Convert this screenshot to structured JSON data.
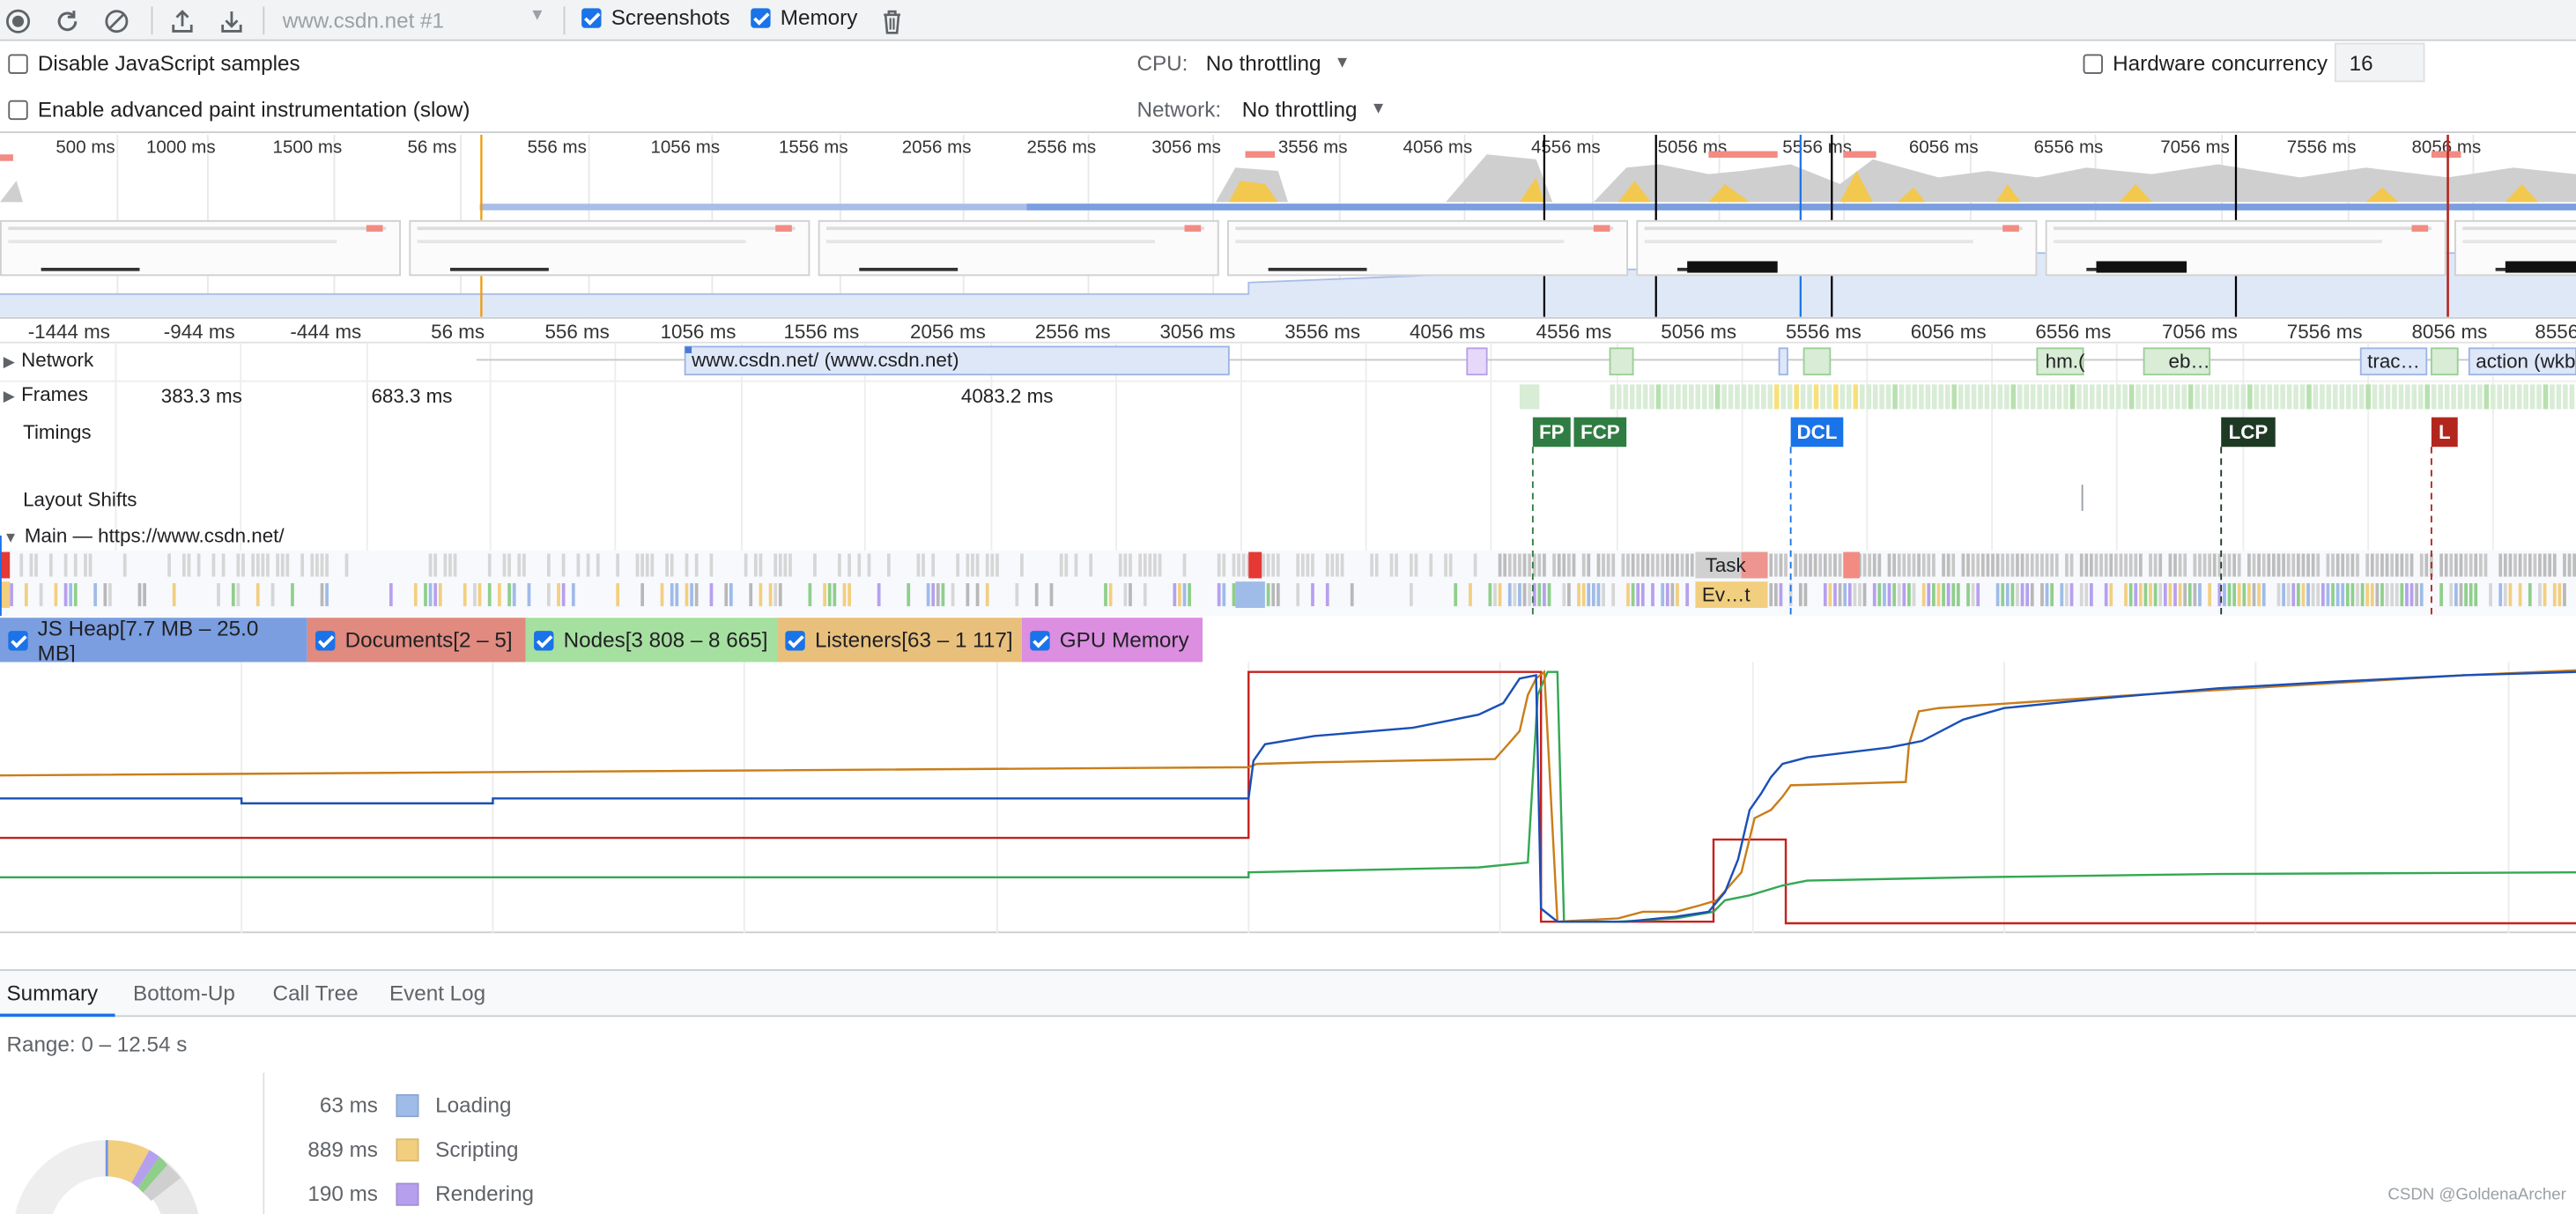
{
  "toolbar": {
    "url_select": "www.csdn.net #1",
    "screenshots_label": "Screenshots",
    "memory_label": "Memory"
  },
  "settings": {
    "disable_js_samples": "Disable JavaScript samples",
    "advanced_paint": "Enable advanced paint instrumentation (slow)",
    "cpu_label": "CPU:",
    "cpu_value": "No throttling",
    "network_label": "Network:",
    "network_value": "No throttling",
    "hw_concurrency_label": "Hardware concurrency",
    "hw_concurrency_value": "16"
  },
  "overview_ticks": [
    "500 ms",
    "1000 ms",
    "1500 ms",
    "56 ms",
    "556 ms",
    "1056 ms",
    "1556 ms",
    "2056 ms",
    "2556 ms",
    "3056 ms",
    "3556 ms",
    "4056 ms",
    "4556 ms",
    "5056 ms",
    "5556 ms",
    "6056 ms",
    "6556 ms",
    "7056 ms",
    "7556 ms",
    "8056 ms"
  ],
  "main_ticks": [
    "-1444 ms",
    "-944 ms",
    "-444 ms",
    "56 ms",
    "556 ms",
    "1056 ms",
    "1556 ms",
    "2056 ms",
    "2556 ms",
    "3056 ms",
    "3556 ms",
    "4056 ms",
    "4556 ms",
    "5056 ms",
    "5556 ms",
    "6056 ms",
    "6556 ms",
    "7056 ms",
    "7556 ms",
    "8056 ms",
    "8556"
  ],
  "tracks": {
    "network": "Network",
    "network_main_request": "www.csdn.net/ (www.csdn.net)",
    "network_req_hm": "hm.(",
    "network_req_eb": "eb…",
    "network_req_trac": "trac…",
    "network_req_action": "action (wkb",
    "frames": "Frames",
    "frame_1": "383.3 ms",
    "frame_2": "683.3 ms",
    "frame_3": "4083.2 ms",
    "timings": "Timings",
    "layout_shifts": "Layout Shifts",
    "main": "Main — https://www.csdn.net/",
    "task_label": "Task",
    "event_label": "Ev…t"
  },
  "markers": {
    "fp": "FP",
    "fcp": "FCP",
    "dcl": "DCL",
    "lcp": "LCP",
    "l": "L"
  },
  "memory_legend": [
    {
      "label": "JS Heap[7.7 MB – 25.0 MB]",
      "color": "#7b9ee0"
    },
    {
      "label": "Documents[2 – 5]",
      "color": "#e08a80"
    },
    {
      "label": "Nodes[3 808 – 8 665]",
      "color": "#a6e0a0"
    },
    {
      "label": "Listeners[63 – 1 117]",
      "color": "#e8c07c"
    },
    {
      "label": "GPU Memory",
      "color": "#dc8ee0"
    }
  ],
  "bottom_tabs": [
    "Summary",
    "Bottom-Up",
    "Call Tree",
    "Event Log"
  ],
  "summary": {
    "range": "Range: 0 – 12.54 s",
    "rows": [
      {
        "value": "63 ms",
        "label": "Loading",
        "color": "#9fbbe8"
      },
      {
        "value": "889 ms",
        "label": "Scripting",
        "color": "#f2cf7f"
      },
      {
        "value": "190 ms",
        "label": "Rendering",
        "color": "#b6a0ee"
      }
    ]
  },
  "watermark": "CSDN @GoldenaArcher"
}
